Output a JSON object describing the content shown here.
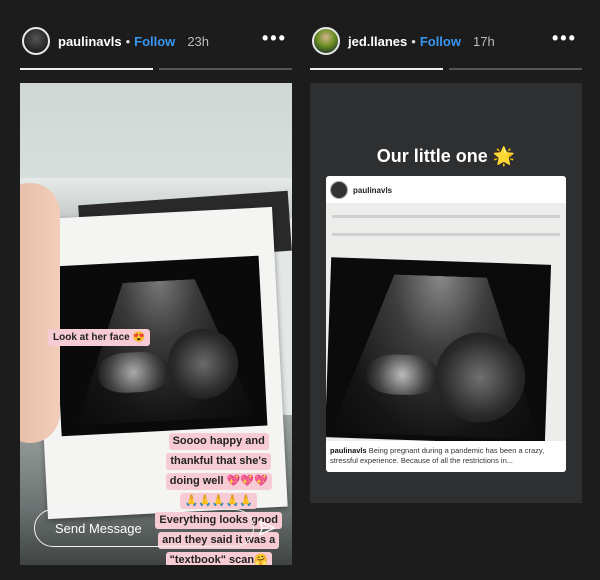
{
  "stories": [
    {
      "username": "paulinavls",
      "separator": "•",
      "follow": "Follow",
      "time": "23h",
      "more": "•••",
      "progress": [
        true,
        false
      ],
      "stickers": {
        "look": "Look at her face 😍"
      },
      "caption_lines": [
        "Soooo happy and",
        "thankful that she's",
        "doing well 💖💖💖",
        "🙏🙏🙏🙏🙏",
        "Everything looks good",
        "and they said it was a",
        "\"textbook\" scan🤗"
      ],
      "send_placeholder": "Send Message"
    },
    {
      "username": "jed.llanes",
      "separator": "•",
      "follow": "Follow",
      "time": "17h",
      "more": "•••",
      "progress": [
        true,
        false
      ],
      "title": "Our little one 🌟",
      "card": {
        "username": "paulinavls",
        "caption_user": "paulinavls",
        "caption_text": "Being pregnant during a pandemic has been a crazy, stressful experience. Because of all the restrictions in..."
      }
    }
  ],
  "colors": {
    "follow": "#3897f0",
    "sticker": "#f7cbd3",
    "background": "#1c1c1c"
  }
}
